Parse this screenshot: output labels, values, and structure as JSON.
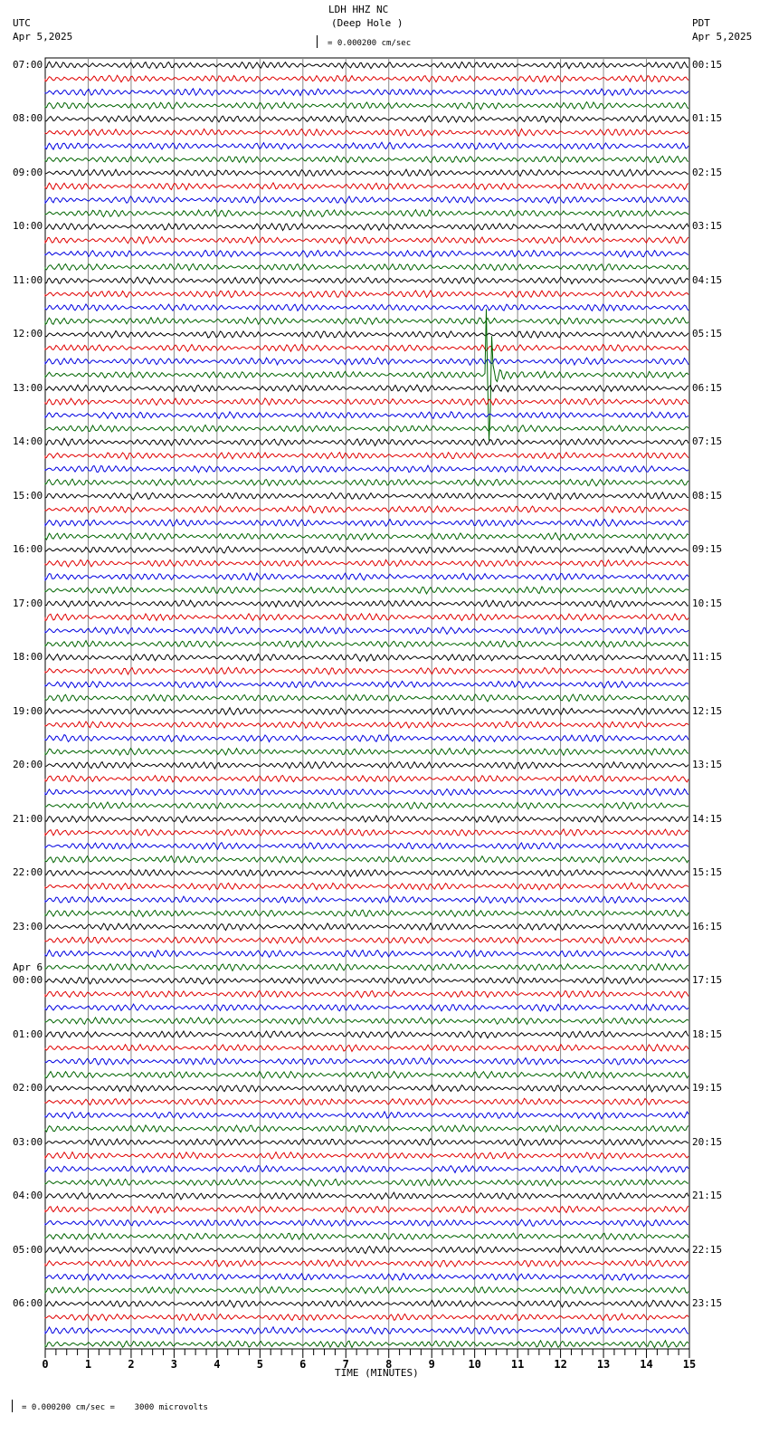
{
  "chart_data": {
    "type": "line",
    "title": "LDH HHZ NC",
    "subtitle": "(Deep Hole )",
    "left_timezone": "UTC",
    "left_date": "Apr 5,2025",
    "right_timezone": "PDT",
    "right_date": "Apr 5,2025",
    "scale_label": "= 0.000200 cm/sec",
    "footer_scale": "= 0.000200 cm/sec =    3000 microvolts",
    "xlabel": "TIME (MINUTES)",
    "xlim": [
      0,
      15
    ],
    "x_ticks": [
      "0",
      "1",
      "2",
      "3",
      "4",
      "5",
      "6",
      "7",
      "8",
      "9",
      "10",
      "11",
      "12",
      "13",
      "14",
      "15"
    ],
    "traces_per_hour": 4,
    "trace_colors": [
      "#000000",
      "#e00000",
      "#0000e0",
      "#006400"
    ],
    "left_hour_labels": [
      "07:00",
      "08:00",
      "09:00",
      "10:00",
      "11:00",
      "12:00",
      "13:00",
      "14:00",
      "15:00",
      "16:00",
      "17:00",
      "18:00",
      "19:00",
      "20:00",
      "21:00",
      "22:00",
      "23:00",
      "00:00",
      "01:00",
      "02:00",
      "03:00",
      "04:00",
      "05:00",
      "06:00"
    ],
    "date_change_label": "Apr 6",
    "right_hour_labels": [
      "00:15",
      "01:15",
      "02:15",
      "03:15",
      "04:15",
      "05:15",
      "06:15",
      "07:15",
      "08:15",
      "09:15",
      "10:15",
      "11:15",
      "12:15",
      "13:15",
      "14:15",
      "15:15",
      "16:15",
      "17:15",
      "18:15",
      "19:15",
      "20:15",
      "21:15",
      "22:15",
      "23:15"
    ],
    "events": [
      {
        "trace_utc": "12:45",
        "minute": 10.3,
        "amplitude": "large"
      }
    ]
  }
}
